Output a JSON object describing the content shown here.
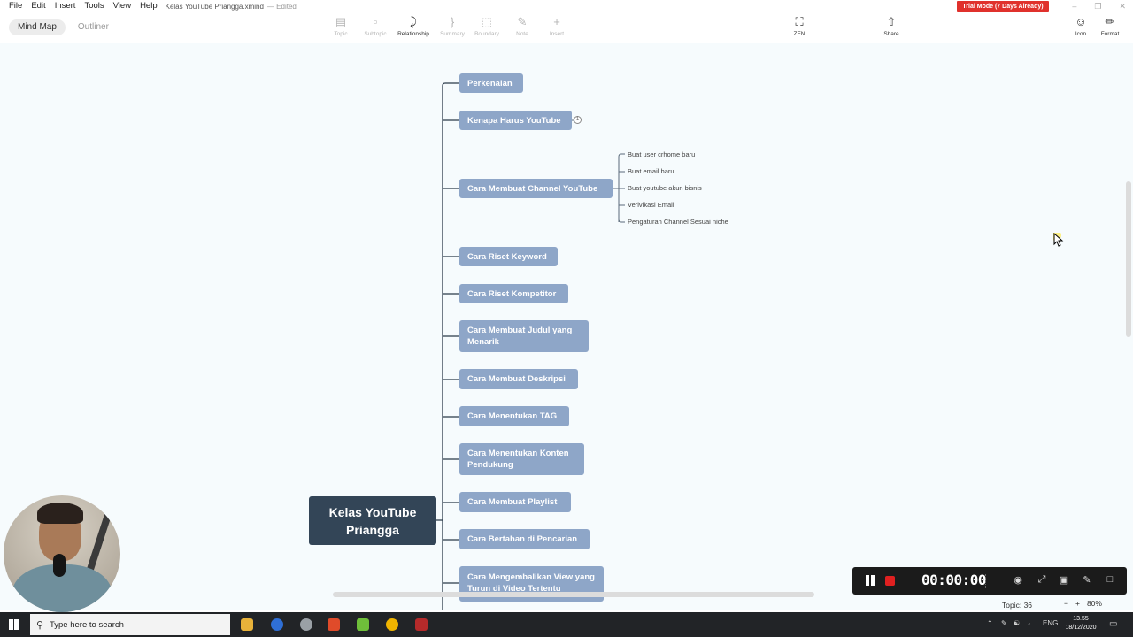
{
  "menubar": {
    "items": [
      "File",
      "Edit",
      "Insert",
      "Tools",
      "View",
      "Help"
    ],
    "doc_title": "Kelas YouTube Priangga.xmind",
    "doc_status": "— Edited",
    "trial_badge": "Trial Mode (7 Days Already)"
  },
  "toolbar": {
    "views": [
      "Mind Map",
      "Outliner"
    ],
    "tools": [
      {
        "label": "Topic",
        "icon": "topic-icon"
      },
      {
        "label": "Subtopic",
        "icon": "subtopic-icon"
      },
      {
        "label": "Relationship",
        "icon": "relationship-icon"
      },
      {
        "label": "Summary",
        "icon": "summary-icon"
      },
      {
        "label": "Boundary",
        "icon": "boundary-icon"
      },
      {
        "label": "Note",
        "icon": "note-icon"
      },
      {
        "label": "Insert",
        "icon": "plus-icon"
      }
    ],
    "zen_label": "ZEN",
    "share_label": "Share",
    "icon_label": "Icon",
    "format_label": "Format"
  },
  "mindmap": {
    "central": "Kelas YouTube Priangga",
    "topics": [
      "Perkenalan",
      "Kenapa Harus YouTube",
      "Cara Membuat Channel YouTube",
      "Cara Riset Keyword",
      "Cara Riset Kompetitor",
      "Cara Membuat Judul yang Menarik",
      "Cara Membuat Deskripsi",
      "Cara Menentukan TAG",
      "Cara Menentukan Konten Pendukung",
      "Cara Membuat Playlist",
      "Cara Bertahan di Pencarian",
      "Cara Mengembalikan View yang Turun di Video Tertentu"
    ],
    "subtopics": [
      "Buat user crhome baru",
      "Buat email baru",
      "Buat youtube akun bisnis",
      "Verivikasi Email",
      "Pengaturan Channel Sesuai niche"
    ],
    "collapsed_count": "1"
  },
  "recorder": {
    "time": "00:00:00"
  },
  "status": {
    "topic_count": "Topic: 36",
    "zoom": "80%"
  },
  "taskbar": {
    "search_placeholder": "Type here to search",
    "language": "ENG",
    "time": "13.55",
    "date": "18/12/2020"
  }
}
